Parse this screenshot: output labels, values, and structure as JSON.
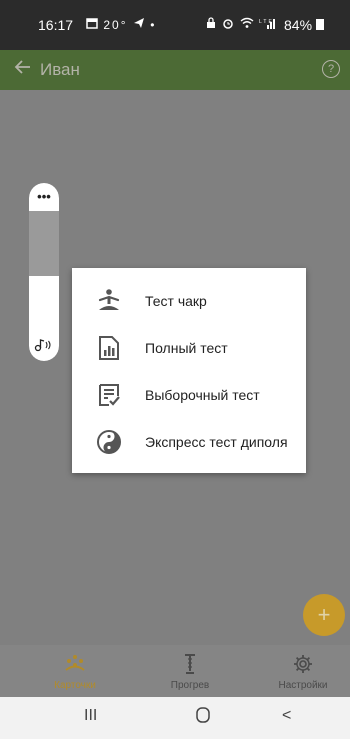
{
  "status_bar": {
    "time": "16:17",
    "left_icons": "20°",
    "battery": "84%"
  },
  "app_bar": {
    "title": "Иван",
    "back_icon": "arrow-left-icon",
    "help_icon": "help-circle-icon",
    "help_glyph": "?",
    "color": "#4c6a35"
  },
  "volume_panel": {
    "menu_glyph": "•••",
    "level": 0.48
  },
  "popup_menu": {
    "items": [
      {
        "label": "Тест чакр",
        "icon": "meditation-icon"
      },
      {
        "label": "Полный тест",
        "icon": "report-chart-icon"
      },
      {
        "label": "Выборочный тест",
        "icon": "checklist-icon"
      },
      {
        "label": "Экспресс тест диполя",
        "icon": "yin-yang-icon"
      }
    ]
  },
  "fab": {
    "glyph": "+",
    "color": "#c79a2a"
  },
  "bottom_nav": {
    "items": [
      {
        "label": "Карточки",
        "icon": "cards-icon",
        "active": true
      },
      {
        "label": "Прогрев",
        "icon": "warm-up-icon",
        "active": false
      },
      {
        "label": "Настройки",
        "icon": "settings-gear-icon",
        "active": false
      }
    ]
  },
  "system_nav": {
    "recents": "III",
    "home": "O",
    "back": "<"
  }
}
